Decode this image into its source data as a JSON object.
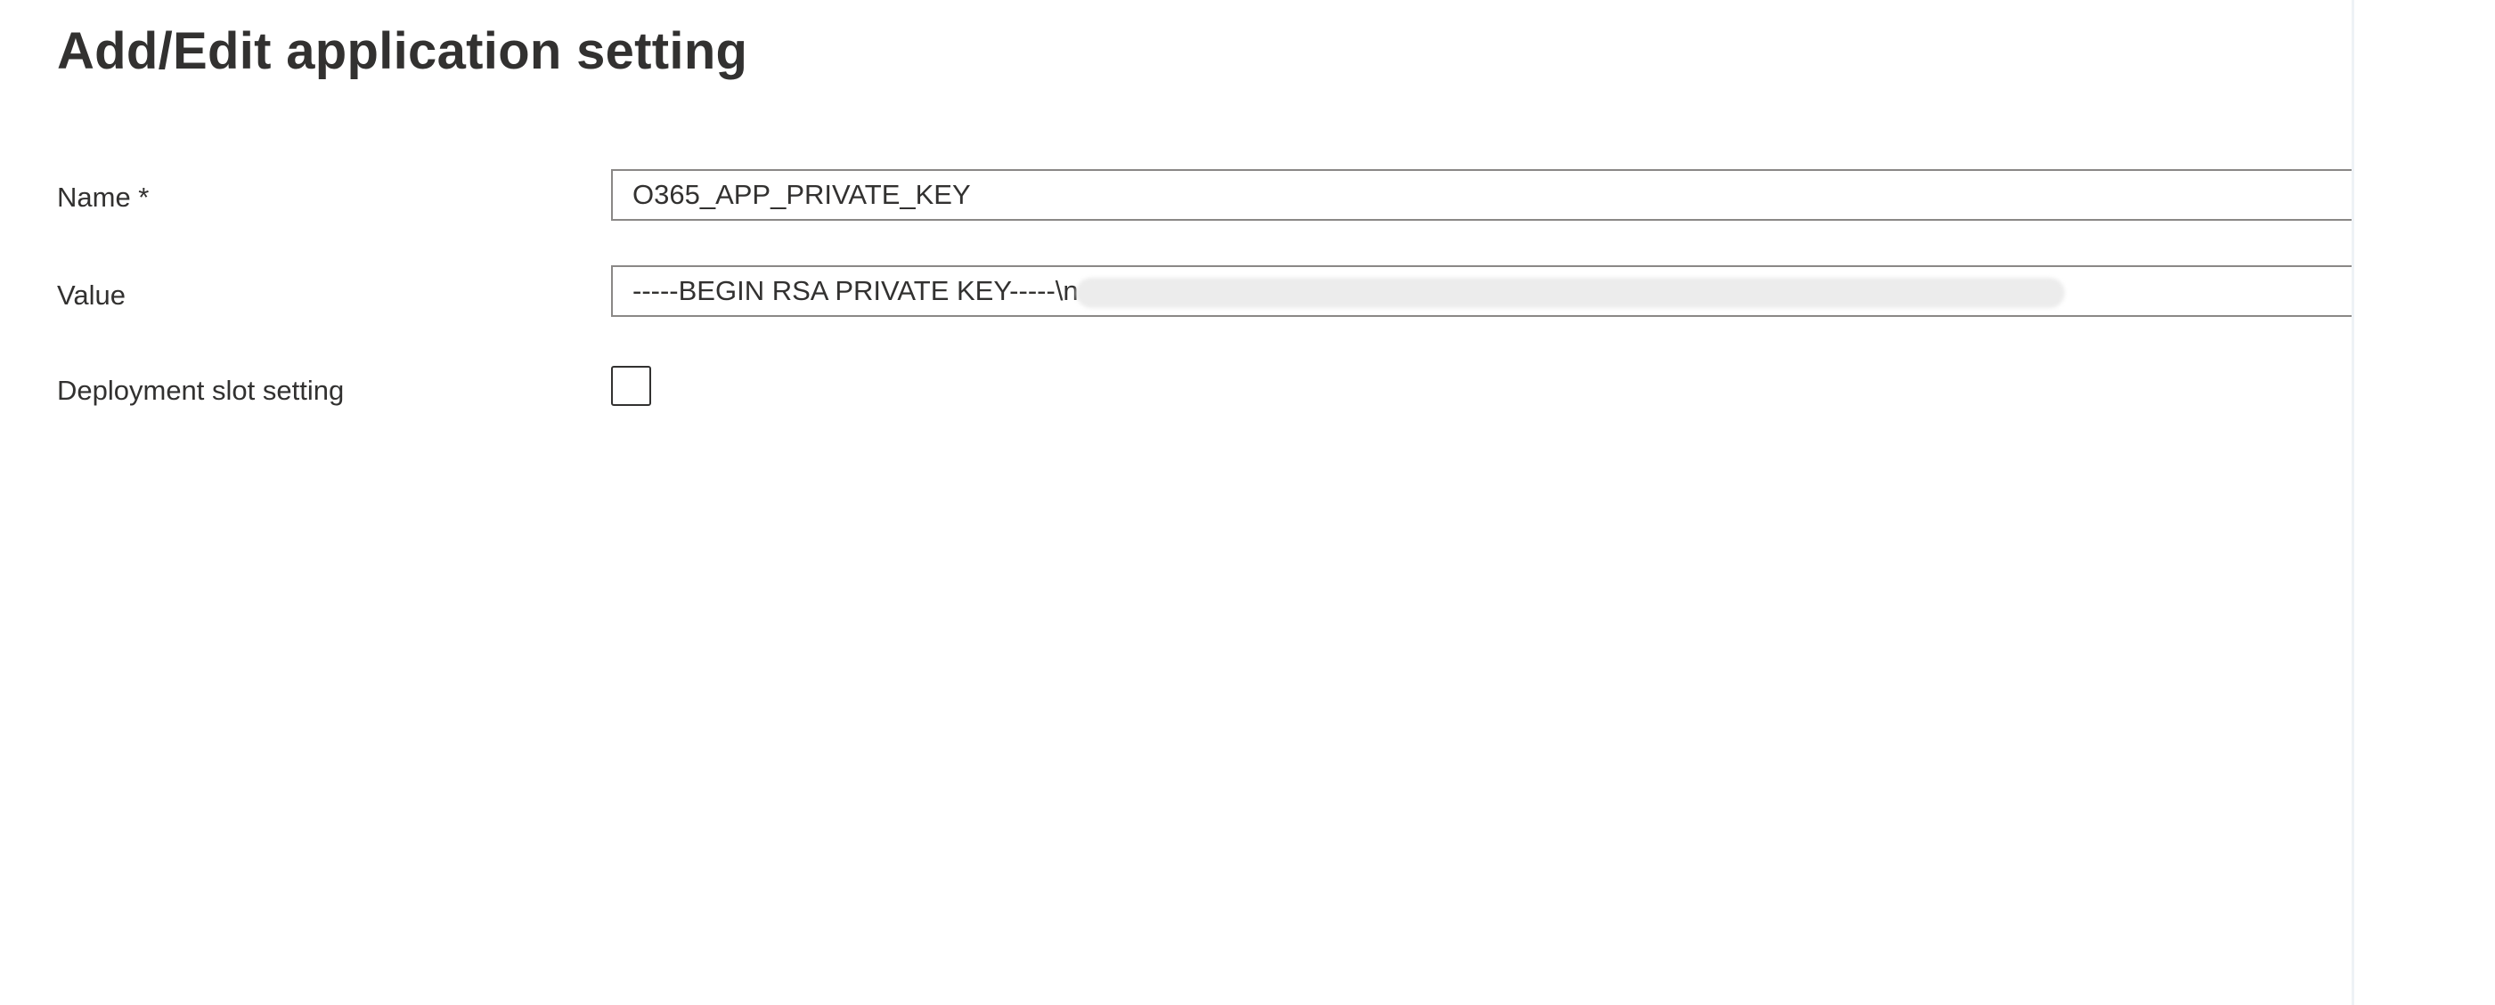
{
  "panel": {
    "title": "Add/Edit application setting",
    "close_icon": "close-icon"
  },
  "fields": {
    "name": {
      "label": "Name *",
      "value": "O365_APP_PRIVATE_KEY",
      "copy_icon": "copy-icon"
    },
    "value": {
      "label": "Value",
      "value": "-----BEGIN RSA PRIVATE KEY-----\\n",
      "redacted": true,
      "copy_icon": "copy-icon"
    },
    "slot_setting": {
      "label": "Deployment slot setting",
      "checked": false
    }
  },
  "colors": {
    "text": "#323130",
    "border": "#8a8886",
    "copy_button_bg": "#f3f2f1"
  }
}
